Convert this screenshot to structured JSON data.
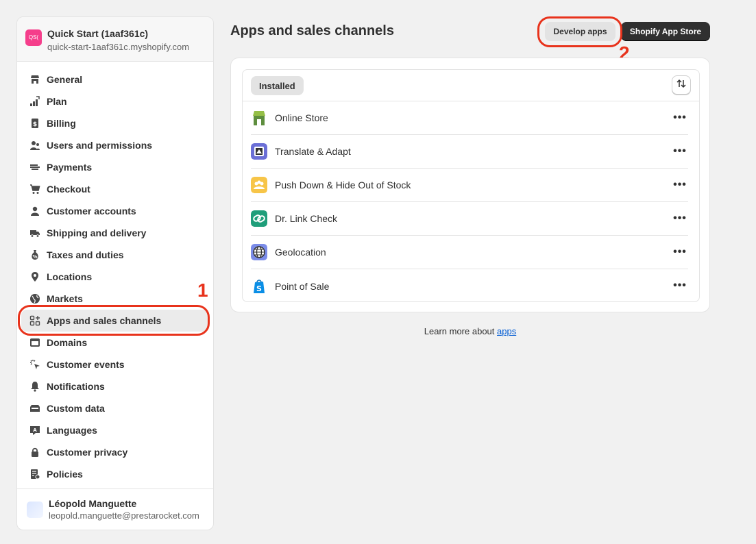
{
  "store": {
    "avatar_text": "QS(",
    "name": "Quick Start (1aaf361c)",
    "domain": "quick-start-1aaf361c.myshopify.com"
  },
  "nav": {
    "general": "General",
    "plan": "Plan",
    "billing": "Billing",
    "users": "Users and permissions",
    "payments": "Payments",
    "checkout": "Checkout",
    "customer_accounts": "Customer accounts",
    "shipping": "Shipping and delivery",
    "taxes": "Taxes and duties",
    "locations": "Locations",
    "markets": "Markets",
    "apps": "Apps and sales channels",
    "domains": "Domains",
    "customer_events": "Customer events",
    "notifications": "Notifications",
    "custom_data": "Custom data",
    "languages": "Languages",
    "customer_privacy": "Customer privacy",
    "policies": "Policies"
  },
  "user": {
    "name": "Léopold Manguette",
    "email": "leopold.manguette@prestarocket.com"
  },
  "page": {
    "title": "Apps and sales channels",
    "develop_apps": "Develop apps",
    "app_store": "Shopify App Store"
  },
  "annotations": {
    "one": "1",
    "two": "2",
    "color": "#e8331c"
  },
  "apps_list": {
    "filter_tab": "Installed",
    "more_glyph": "•••",
    "items": [
      {
        "name": "Online Store",
        "icon": "online-store-icon"
      },
      {
        "name": "Translate & Adapt",
        "icon": "translate-adapt-icon"
      },
      {
        "name": "Push Down & Hide Out of Stock",
        "icon": "push-down-icon"
      },
      {
        "name": "Dr. Link Check",
        "icon": "link-check-icon"
      },
      {
        "name": "Geolocation",
        "icon": "geolocation-icon"
      },
      {
        "name": "Point of Sale",
        "icon": "point-of-sale-icon"
      }
    ]
  },
  "footer_note": {
    "prefix": "Learn more about",
    "link": "apps"
  },
  "colors": {
    "background": "#f1f1f1",
    "active_nav": "#ebebeb",
    "primary_button": "#303030",
    "link": "#005bd3"
  }
}
